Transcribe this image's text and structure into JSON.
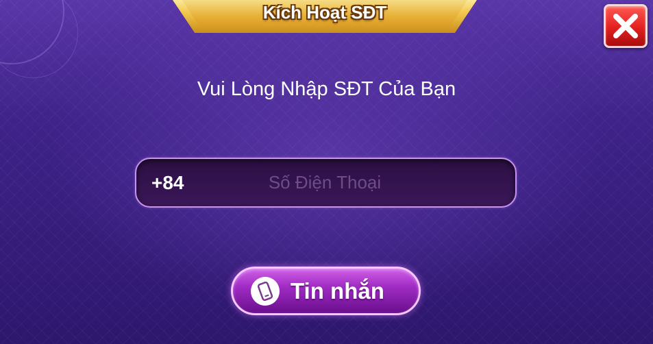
{
  "dialog": {
    "title": "Kích Hoạt SĐT",
    "prompt": "Vui Lòng Nhập SĐT Của Bạn"
  },
  "phone": {
    "country_code": "+84",
    "placeholder": "Số Điện Thoại",
    "value": ""
  },
  "actions": {
    "sms_label": "Tin nhắn",
    "close_icon": "close-icon",
    "sms_icon": "phone-icon"
  },
  "colors": {
    "background": "#3f2389",
    "title_plate": "#f2c84d",
    "close_button": "#e21f1f",
    "sms_button": "#a12cc4"
  }
}
